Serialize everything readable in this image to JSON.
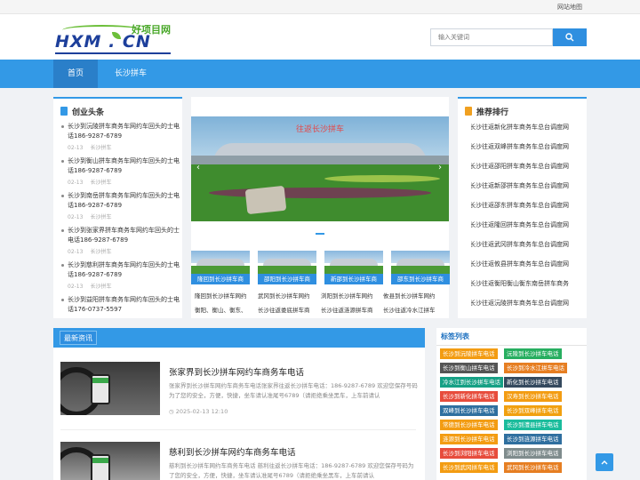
{
  "topbar": {
    "sitemap": "网站地图"
  },
  "logo": {
    "en": "HXM . CN",
    "cn": "好项目网"
  },
  "search": {
    "placeholder": "输入关键词"
  },
  "nav": {
    "home": "首页",
    "changsha": "长沙拼车"
  },
  "left": {
    "title": "创业头条",
    "items": [
      {
        "title": "长沙到沅陵拼车商务车网约车回头的士电话186-9287-6789",
        "date": "02-13",
        "cat": "长沙拼车"
      },
      {
        "title": "长沙到衡山拼车商务车网约车回头的士电话186-9287-6789",
        "date": "02-13",
        "cat": "长沙拼车"
      },
      {
        "title": "长沙到南岳拼车商务车网约车回头的士电话186-9287-6789",
        "date": "02-13",
        "cat": "长沙拼车"
      },
      {
        "title": "长沙到张家界拼车商务车网约车回头的士电话186-9287-6789",
        "date": "02-13",
        "cat": "长沙拼车"
      },
      {
        "title": "长沙到慈利拼车商务车网约车回头的士电话186-9287-6789",
        "date": "02-13",
        "cat": "长沙拼车"
      },
      {
        "title": "长沙到益阳拼车商务车网约车回头的士电话176-0737-5597",
        "date": "",
        "cat": ""
      }
    ]
  },
  "slider": {
    "caption": "往返长沙拼车",
    "stone_text": "东方红广场"
  },
  "thumbs": [
    {
      "label": "隆回到长沙拼车商"
    },
    {
      "label": "邵阳到长沙拼车商"
    },
    {
      "label": "新邵到长沙拼车商"
    },
    {
      "label": "邵东到长沙拼车商"
    }
  ],
  "thumb_links": [
    [
      "隆回到长沙拼车网约",
      "衡阳、衡山、衡东、"
    ],
    [
      "武冈到长沙拼车网约",
      "长沙往返娄底拼车商"
    ],
    [
      "浏阳到长沙拼车网约",
      "长沙往返涟源拼车商"
    ],
    [
      "攸县到长沙拼车网约",
      "长沙往返冷水江拼车"
    ]
  ],
  "right": {
    "title": "推荐排行",
    "items": [
      "长沙往返新化拼车商务车总台调度网",
      "长沙往返双峰拼车商务车总台调度网",
      "长沙往返邵阳拼车商务车总台调度网",
      "长沙往返新邵拼车商务车总台调度网",
      "长沙往返邵东拼车商务车总台调度网",
      "长沙往返隆回拼车商务车总台调度网",
      "长沙往返武冈拼车商务车总台调度网",
      "长沙往返攸县拼车商务车总台调度网",
      "长沙往返衡阳衡山衡东南岳拼车商务",
      "长沙往返沅陵拼车商务车总台调度网"
    ]
  },
  "latest": {
    "title": "最新资讯",
    "articles": [
      {
        "title": "张家界到长沙拼车网约车商务车电话",
        "desc": "张家界到长沙拼车网约车商务车电话张家界往返长沙拼车电话：186-9287-6789 欢迎您保存号码为了您的安全，方便，快捷，坐车请认准尾号6789（请拒绝乘坐黑车，上车前请认",
        "date": "2025-02-13 12:10"
      },
      {
        "title": "慈利到长沙拼车网约车商务车电话",
        "desc": "慈利到长沙拼车网约车商务车电话 慈利往返长沙拼车电话：186-9287-6789 欢迎您保存号码为了您的安全，方便，快捷，坐车请认准尾号6789（请拒绝乘坐黑车，上车前请认",
        "date": ""
      }
    ]
  },
  "tags": {
    "title": "标签列表",
    "items": [
      {
        "text": "长沙到沅陵拼车电话",
        "color": "#f39c12"
      },
      {
        "text": "沅陵到长沙拼车电话",
        "color": "#27ae60"
      },
      {
        "text": "长沙到衡山拼车电话",
        "color": "#555555"
      },
      {
        "text": "长沙到冷水江拼车电话",
        "color": "#e67e22"
      },
      {
        "text": "冷水江到长沙拼车电话",
        "color": "#16a085"
      },
      {
        "text": "新化到长沙拼车电话",
        "color": "#34495e"
      },
      {
        "text": "长沙到新化拼车电话",
        "color": "#e74c3c"
      },
      {
        "text": "汉寿到长沙拼车电话",
        "color": "#f39c12"
      },
      {
        "text": "双峰到长沙拼车电话",
        "color": "#2f6f9f"
      },
      {
        "text": "长沙到双峰拼车电话",
        "color": "#f1a00f"
      },
      {
        "text": "常德到长沙拼车电话",
        "color": "#f39c12"
      },
      {
        "text": "长沙到澧县拼车电话",
        "color": "#1abc9c"
      },
      {
        "text": "涟源到长沙拼车电话",
        "color": "#f39c12"
      },
      {
        "text": "长沙到涟源拼车电话",
        "color": "#2f6f9f"
      },
      {
        "text": "长沙到浏阳拼车电话",
        "color": "#e74c3c"
      },
      {
        "text": "浏阳到长沙拼车电话",
        "color": "#7f8c8d"
      },
      {
        "text": "长沙到武冈拼车电话",
        "color": "#f39c12"
      },
      {
        "text": "武冈到长沙拼车电话",
        "color": "#e67e22"
      }
    ]
  }
}
